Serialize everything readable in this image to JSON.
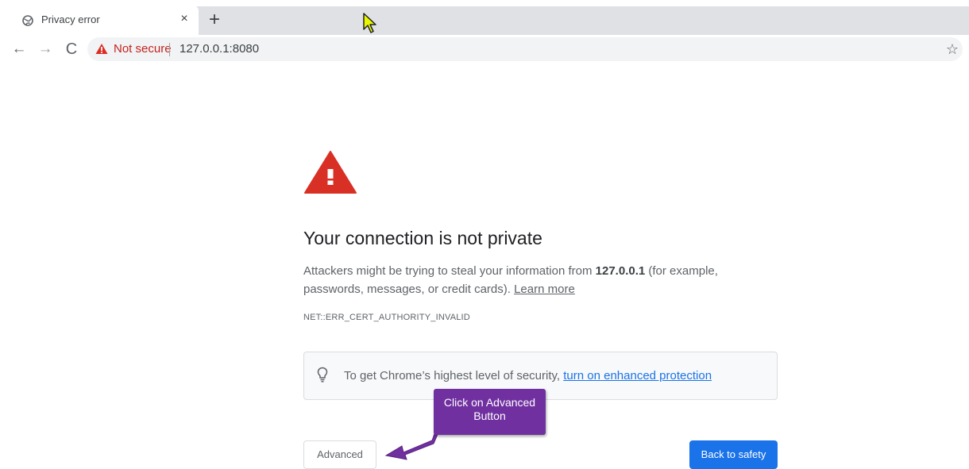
{
  "tab": {
    "title": "Privacy error",
    "close_glyph": "×",
    "new_tab_glyph": "+"
  },
  "toolbar": {
    "back_glyph": "←",
    "forward_glyph": "→",
    "reload_glyph": "C",
    "security_label": "Not secure",
    "url": "127.0.0.1:8080",
    "bookmark_glyph": "☆"
  },
  "page": {
    "heading": "Your connection is not private",
    "body_prefix": "Attackers might be trying to steal your information from ",
    "host": "127.0.0.1",
    "body_suffix": " (for example, passwords, messages, or credit cards). ",
    "learn_more": "Learn more",
    "error_code": "NET::ERR_CERT_AUTHORITY_INVALID",
    "enhanced_prefix": "To get Chrome’s highest level of security, ",
    "enhanced_link": "turn on enhanced protection",
    "advanced_label": "Advanced",
    "back_to_safety_label": "Back to safety"
  },
  "callout": {
    "line1": "Click on Advanced",
    "line2": "Button"
  },
  "icons": {
    "favicon": "globe-icon",
    "omnibox_warning": "warning-triangle-icon",
    "page_warning": "warning-triangle-icon",
    "enhanced_tip": "lightbulb-icon",
    "bookmark": "star-icon"
  },
  "colors": {
    "danger_red": "#d93025",
    "not_secure_text": "#c5221f",
    "link_blue": "#1a73e8",
    "primary_button": "#1a73e8",
    "callout_purple": "#7030a0",
    "cursor_yellow": "#e8f700"
  }
}
